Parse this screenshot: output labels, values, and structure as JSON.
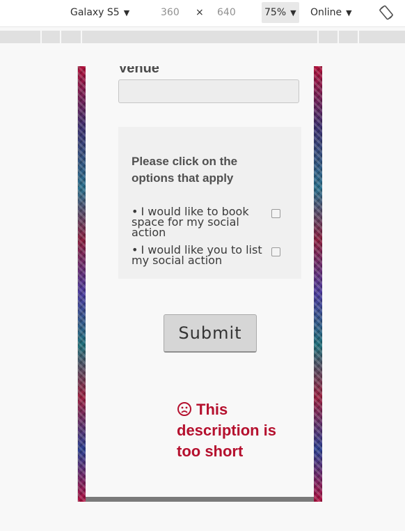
{
  "toolbar": {
    "device": "Galaxy S5",
    "width": "360",
    "times": "×",
    "height": "640",
    "zoom": "75%",
    "network": "Online",
    "caret_icon": "caret-down-icon",
    "rotate_icon": "rotate-icon"
  },
  "form": {
    "venue_label": "Venue",
    "venue_value": "",
    "options_heading": "Please click on the options that apply",
    "options": [
      {
        "label": "I would like to book space for my social action",
        "checked": false
      },
      {
        "label": "I would like you to list my social action",
        "checked": false
      }
    ],
    "submit_label": "Submit",
    "error_icon": "frown-face-icon",
    "error_message": "This description is too short",
    "error_color": "#b5102e"
  }
}
